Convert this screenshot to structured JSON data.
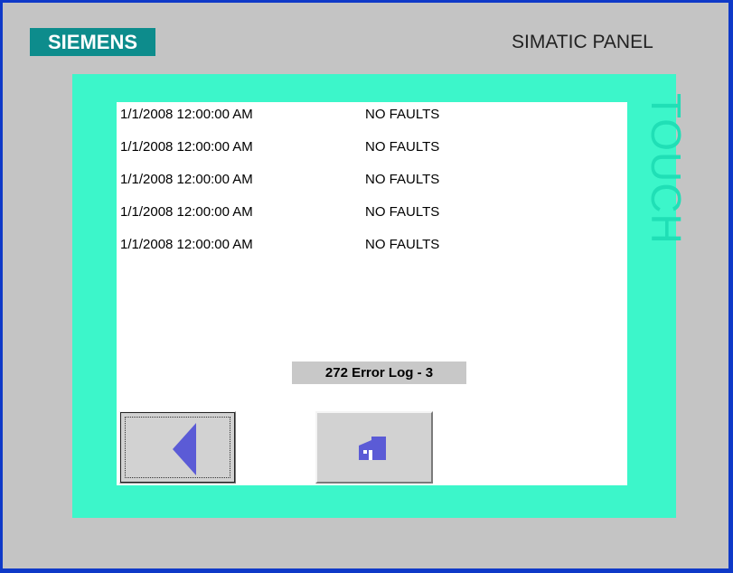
{
  "device": {
    "brand": "SIEMENS",
    "model": "SIMATIC PANEL",
    "frame_label": "TOUCH"
  },
  "screen": {
    "title": "272 Error Log - 3",
    "log_entries": [
      {
        "datetime": "1/1/2008 12:00:00 AM",
        "status": "NO FAULTS"
      },
      {
        "datetime": "1/1/2008 12:00:00 AM",
        "status": "NO FAULTS"
      },
      {
        "datetime": "1/1/2008 12:00:00 AM",
        "status": "NO FAULTS"
      },
      {
        "datetime": "1/1/2008 12:00:00 AM",
        "status": "NO FAULTS"
      },
      {
        "datetime": "1/1/2008 12:00:00 AM",
        "status": "NO FAULTS"
      }
    ]
  },
  "buttons": {
    "back_icon": "left-triangle-icon",
    "home_icon": "factory-icon"
  },
  "colors": {
    "bezel_border": "#0f39c8",
    "bezel": "#c4c4c4",
    "logo_bg": "#0d8c8c",
    "touch_frame": "#3cf6ca",
    "icon_blue": "#5b5bd6"
  }
}
